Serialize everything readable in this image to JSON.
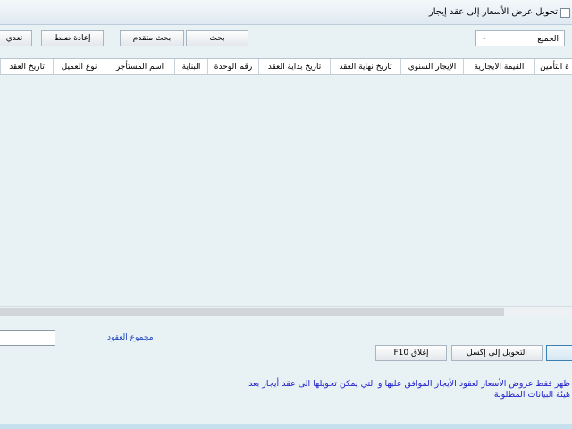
{
  "window": {
    "title": "تحويل عرض الأسعار إلى عقد إيجار"
  },
  "toolbar": {
    "edit_label": "تعدي",
    "reset_label": "إعادة ضبط",
    "advanced_search_label": "بحث متقدم",
    "search_label": "بحث",
    "filter_value": "الجميع"
  },
  "grid": {
    "columns": [
      "ة التأمين",
      "القيمة الايجارية",
      "الإيجار السنوي",
      "تاريخ نهاية العقد",
      "تاريخ بداية العقد",
      "رقم الوحدة",
      "البناية",
      "اسم المستأجر",
      "نوع العميل",
      "تاريخ العقد"
    ]
  },
  "footer": {
    "total_label": "مجموع العقود",
    "total_value": "",
    "close_label": "إغلاق F10",
    "excel_label": "التحويل إلى إكسل",
    "note_line1": "ظهر فقط عروض الأسعار لعقود الأيجار الموافق عليها و التي يمكن تحويلها الى عقد أيجار بعد",
    "note_line2": "هيئة البيانات المطلوبة"
  }
}
